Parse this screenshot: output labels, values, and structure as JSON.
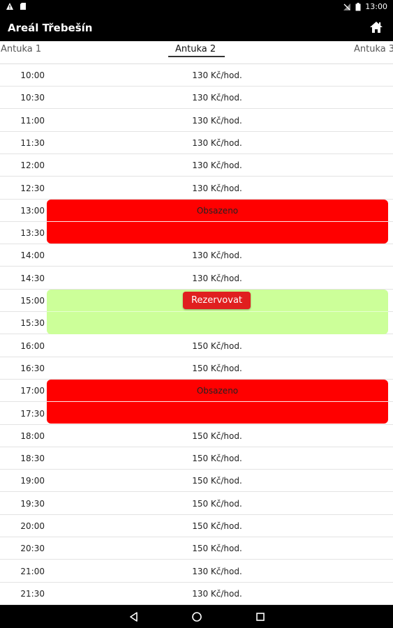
{
  "status_bar": {
    "time": "13:00",
    "left_icons": [
      "warning-icon",
      "sd-card-icon"
    ],
    "right_icons": [
      "no-signal-icon",
      "battery-icon"
    ]
  },
  "app_bar": {
    "title": "Areál Třebešín",
    "action_icon": "home-icon"
  },
  "tabs": [
    {
      "label": "Antuka 1",
      "active": false
    },
    {
      "label": "Antuka 2",
      "active": true
    },
    {
      "label": "Antuka 3",
      "active": false
    }
  ],
  "schedule": {
    "rows": [
      {
        "time": "10:00",
        "price": "130 Kč/hod."
      },
      {
        "time": "10:30",
        "price": "130 Kč/hod."
      },
      {
        "time": "11:00",
        "price": "130 Kč/hod."
      },
      {
        "time": "11:30",
        "price": "130 Kč/hod."
      },
      {
        "time": "12:00",
        "price": "130 Kč/hod."
      },
      {
        "time": "12:30",
        "price": "130 Kč/hod."
      },
      {
        "time": "13:00",
        "price": ""
      },
      {
        "time": "13:30",
        "price": ""
      },
      {
        "time": "14:00",
        "price": "130 Kč/hod."
      },
      {
        "time": "14:30",
        "price": "130 Kč/hod."
      },
      {
        "time": "15:00",
        "price": ""
      },
      {
        "time": "15:30",
        "price": ""
      },
      {
        "time": "16:00",
        "price": "150 Kč/hod."
      },
      {
        "time": "16:30",
        "price": "150 Kč/hod."
      },
      {
        "time": "17:00",
        "price": ""
      },
      {
        "time": "17:30",
        "price": ""
      },
      {
        "time": "18:00",
        "price": "150 Kč/hod."
      },
      {
        "time": "18:30",
        "price": "150 Kč/hod."
      },
      {
        "time": "19:00",
        "price": "150 Kč/hod."
      },
      {
        "time": "19:30",
        "price": "150 Kč/hod."
      },
      {
        "time": "20:00",
        "price": "150 Kč/hod."
      },
      {
        "time": "20:30",
        "price": "150 Kč/hod."
      },
      {
        "time": "21:00",
        "price": "130 Kč/hod."
      },
      {
        "time": "21:30",
        "price": "130 Kč/hod."
      }
    ],
    "booked_1": {
      "from": "13:00",
      "to": "14:00",
      "label": "Obsazeno",
      "color": "#ff0000"
    },
    "selected": {
      "from": "15:00",
      "to": "16:00",
      "button_label": "Rezervovat",
      "color": "#ccff99",
      "button_color": "#e01f1f"
    },
    "booked_2": {
      "from": "17:00",
      "to": "18:00",
      "label": "Obsazeno",
      "color": "#ff0000"
    }
  },
  "nav_bar": {
    "buttons": [
      "back-icon",
      "home-circle-icon",
      "recents-icon"
    ]
  }
}
